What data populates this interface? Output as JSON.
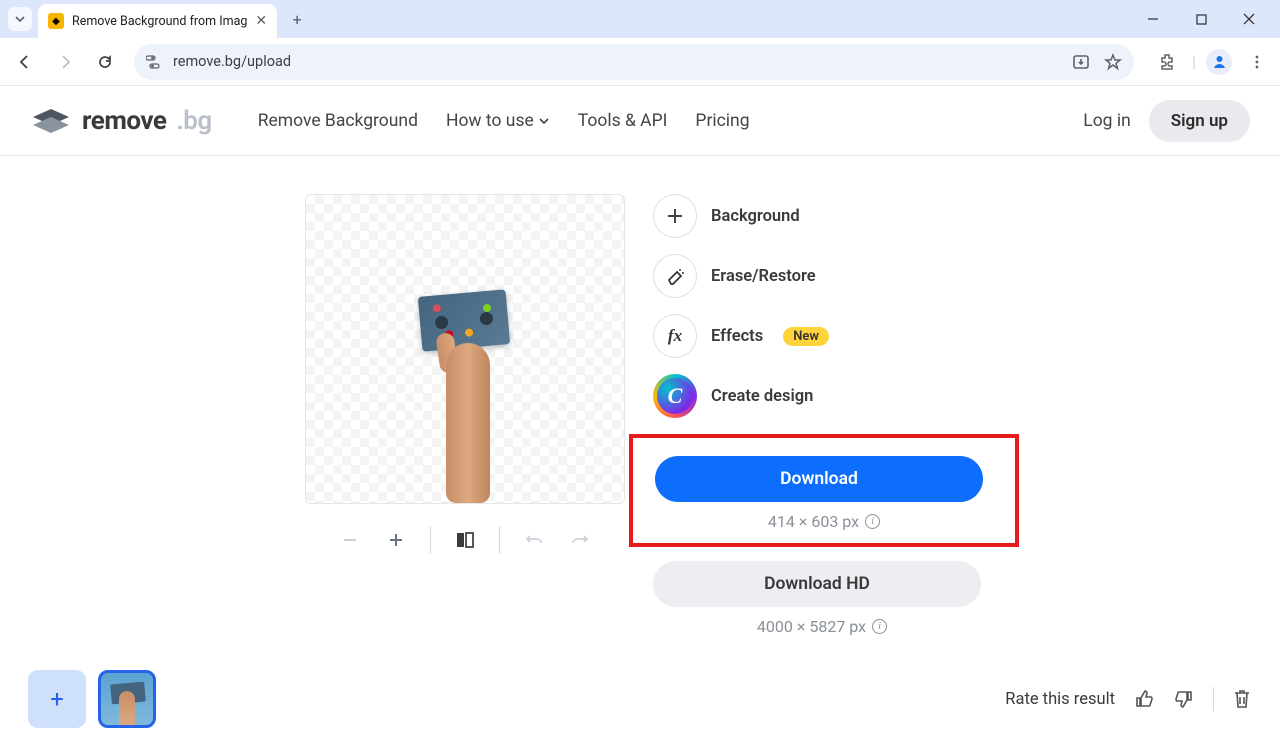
{
  "browser": {
    "tab_title": "Remove Background from Imag",
    "url": "remove.bg/upload"
  },
  "header": {
    "logo_primary": "remove",
    "logo_secondary": ".bg",
    "nav": {
      "remove_bg": "Remove Background",
      "how_to_use": "How to use",
      "tools_api": "Tools & API",
      "pricing": "Pricing"
    },
    "login": "Log in",
    "signup": "Sign up"
  },
  "actions": {
    "background": "Background",
    "erase_restore": "Erase/Restore",
    "effects": "Effects",
    "effects_badge": "New",
    "create_design": "Create design"
  },
  "download": {
    "primary": "Download",
    "primary_dim": "414 × 603 px",
    "hd": "Download HD",
    "hd_dim": "4000 × 5827 px"
  },
  "footer": {
    "rate": "Rate this result"
  }
}
